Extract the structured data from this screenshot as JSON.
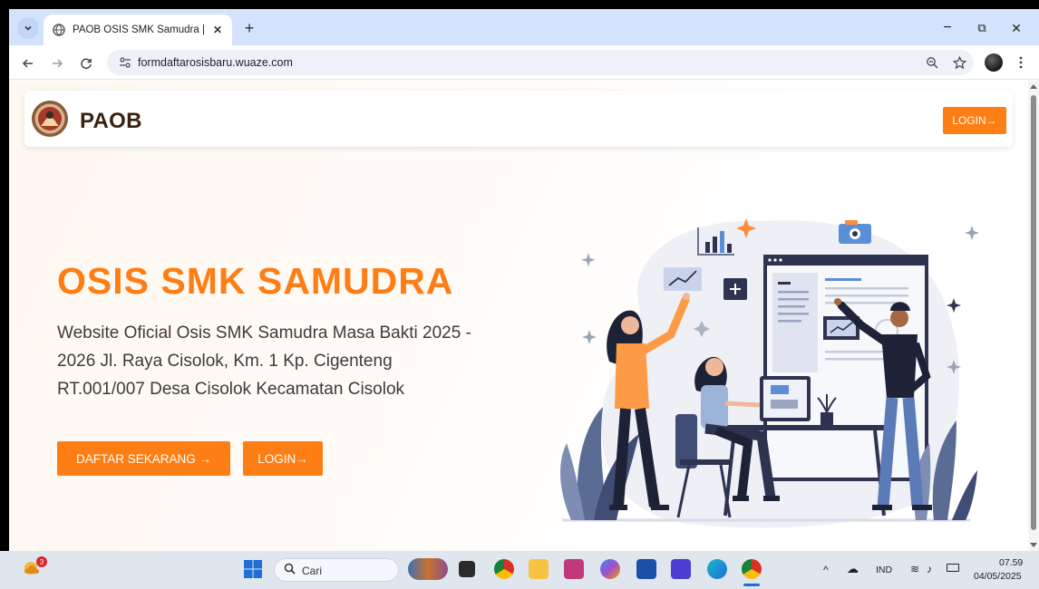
{
  "browser": {
    "tab_title": "PAOB OSIS SMK Samudra | Hom",
    "new_tab": "+",
    "url": "formdaftarosisbaru.wuaze.com",
    "window_controls": {
      "minimize": "−",
      "restore": "⧉",
      "close": "✕"
    }
  },
  "site": {
    "brand": "PAOB",
    "nav_login": "LOGIN→",
    "hero_title": "OSIS SMK SAMUDRA",
    "hero_description": "Website Oficial Osis SMK Samudra Masa Bakti 2025 - 2026 Jl. Raya Cisolok, Km. 1 Kp. Cigenteng RT.001/007 Desa Cisolok Kecamatan Cisolok",
    "daftar_button": "DAFTAR SEKARANG →",
    "login_button": "LOGIN→"
  },
  "taskbar": {
    "notification_count": "3",
    "search_placeholder": "Cari",
    "language": "IND",
    "time": "07.59",
    "date": "04/05/2025"
  },
  "colors": {
    "accent": "#fd7e14",
    "brand_text": "#3a2210",
    "tabstrip": "#d3e3fd"
  }
}
